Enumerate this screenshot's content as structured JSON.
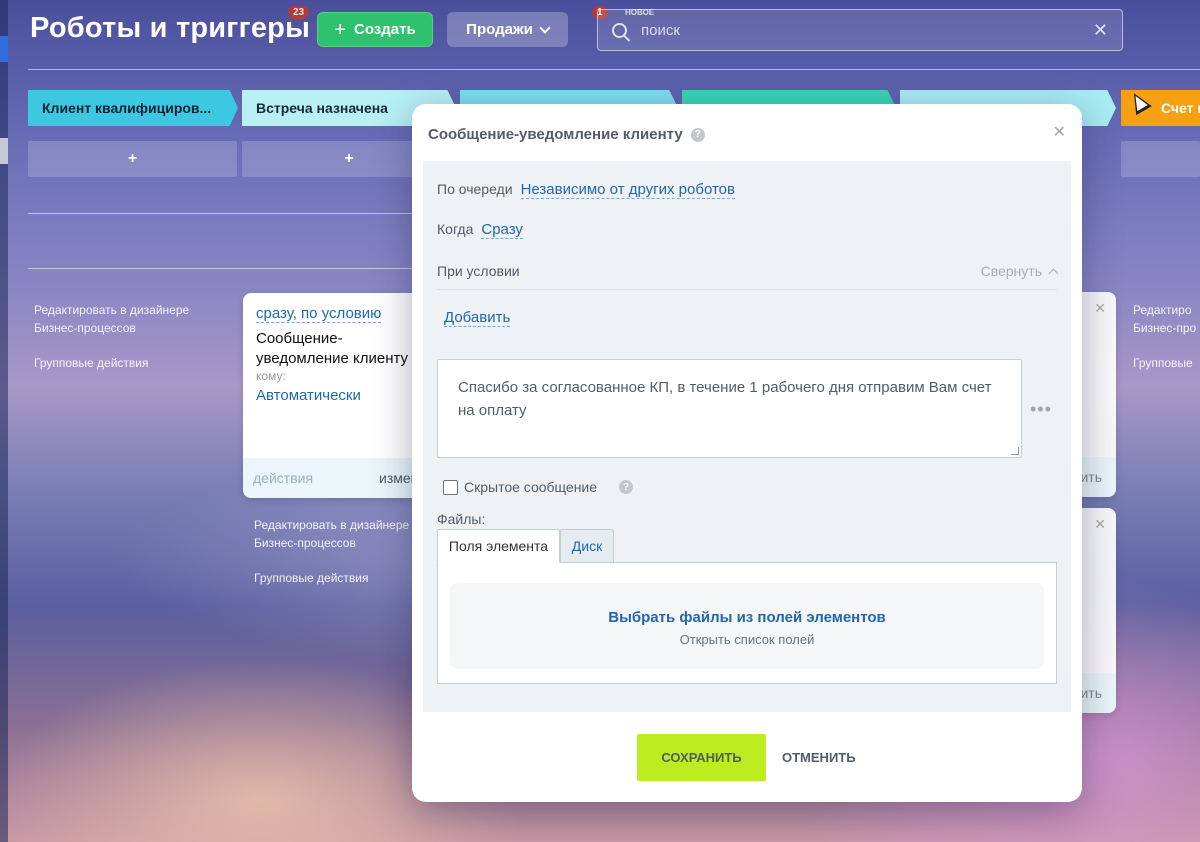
{
  "header": {
    "title": "Роботы и триггеры",
    "badge_count_1": "23",
    "badge_count_2": "1",
    "new_label": "НОВОЕ",
    "create_label": "Создать",
    "sales_label": "Продажи",
    "search_placeholder": "поиск"
  },
  "stages": [
    {
      "label": "Клиент квалифициров...",
      "color": "#3bc8e0"
    },
    {
      "label": "Встреча назначена",
      "color": "#b8f0f6"
    },
    {
      "label": "",
      "color": "#7de0ef"
    },
    {
      "label": "",
      "color": "#39d6b5"
    },
    {
      "label": "",
      "color": "#a9ecf4"
    },
    {
      "label": "Счет выс",
      "color": "#f8a013"
    }
  ],
  "add_symbol": "+",
  "side_links": {
    "designer": "Редактировать в дизайнере Бизнес-процессов",
    "designer_right": "Редактиро Бизнес-про",
    "group": "Групповые действия",
    "group_right": "Групповые"
  },
  "robot_card": {
    "trigger": "сразу, по условию",
    "title": "Сообщение-уведомление клиенту",
    "to_label": "кому:",
    "to_value": "Автоматически",
    "actions_label": "действия",
    "change_label": "измен"
  },
  "right_card_footer": "ить",
  "modal": {
    "title": "Сообщение-уведомление клиенту",
    "queue_label": "По очереди",
    "queue_value": "Независимо от других роботов",
    "when_label": "Когда",
    "when_value": "Сразу",
    "condition_label": "При условии",
    "collapse_label": "Свернуть",
    "add_label": "Добавить",
    "message_text": "Спасибо за согласованное КП, в течение 1 рабочего дня отправим Вам счет на оплату",
    "hidden_message_label": "Скрытое сообщение",
    "files_label": "Файлы:",
    "tabs": [
      {
        "label": "Поля элемента",
        "active": true
      },
      {
        "label": "Диск",
        "active": false
      }
    ],
    "pick_files_label": "Выбрать файлы из полей элементов",
    "open_fields_label": "Открыть список полей",
    "save_label": "СОХРАНИТЬ",
    "cancel_label": "ОТМЕНИТЬ"
  },
  "colors": {
    "create_button": "#2fc26e",
    "save_button": "#bbed21",
    "link": "#2067b0",
    "last_stage": "#f8a013"
  }
}
